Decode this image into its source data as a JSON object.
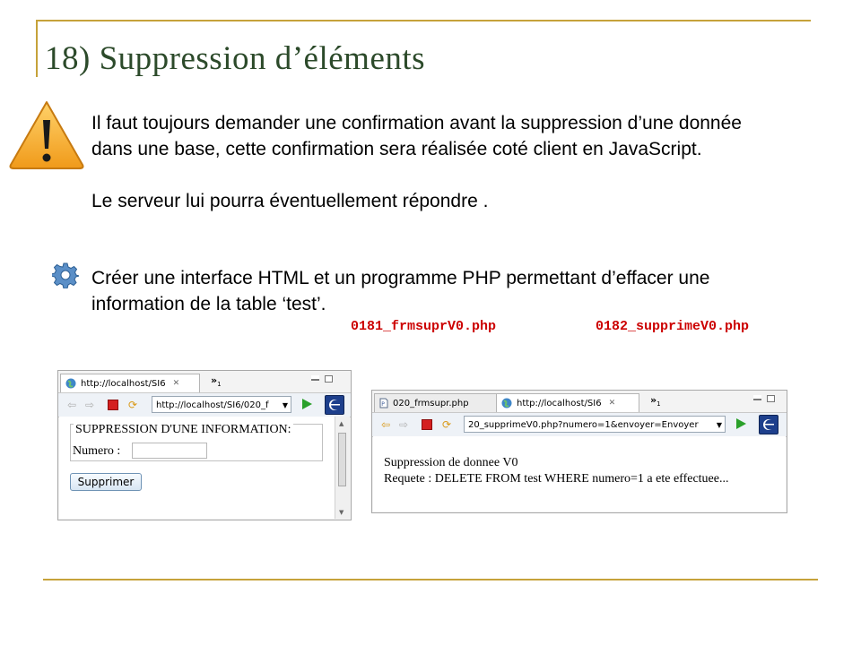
{
  "slide": {
    "title": "18) Suppression d’éléments",
    "paragraph1_line1": "Il faut toujours demander une confirmation avant la suppression d’une donnée",
    "paragraph1_line2": "dans une base, cette confirmation sera réalisée coté client en JavaScript.",
    "paragraph2": "Le serveur lui pourra éventuellement répondre .",
    "paragraph3_line1": "Créer une interface HTML et un programme PHP permettant d’effacer une",
    "paragraph3_line2": "information de la table ‘test’.",
    "file1": "0181_frmsuprV0.php",
    "file2": "0182_supprimeV0.php",
    "warning_icon": "warning-icon",
    "exercise_icon": "gear-icon"
  },
  "browser1": {
    "tab_label": "http://localhost/SI6",
    "overflow_label": "»",
    "overflow_count": "1",
    "url": "http://localhost/SI6/020_f",
    "legend": "SUPPRESSION D'UNE INFORMATION:",
    "field_label": "Numero :",
    "field_value": "",
    "button_label": "Supprimer"
  },
  "browser2": {
    "tab1_label": "020_frmsupr.php",
    "tab2_label": "http://localhost/SI6",
    "overflow_label": "»",
    "overflow_count": "1",
    "url": "20_supprimeV0.php?numero=1&envoyer=Envoyer",
    "line1": "Suppression de donnee V0",
    "line2": "Requete : DELETE FROM test WHERE numero=1 a ete effectuee..."
  },
  "colors": {
    "accent_rule": "#c6a23a",
    "title": "#2c4a2a",
    "code": "#cc0000"
  }
}
